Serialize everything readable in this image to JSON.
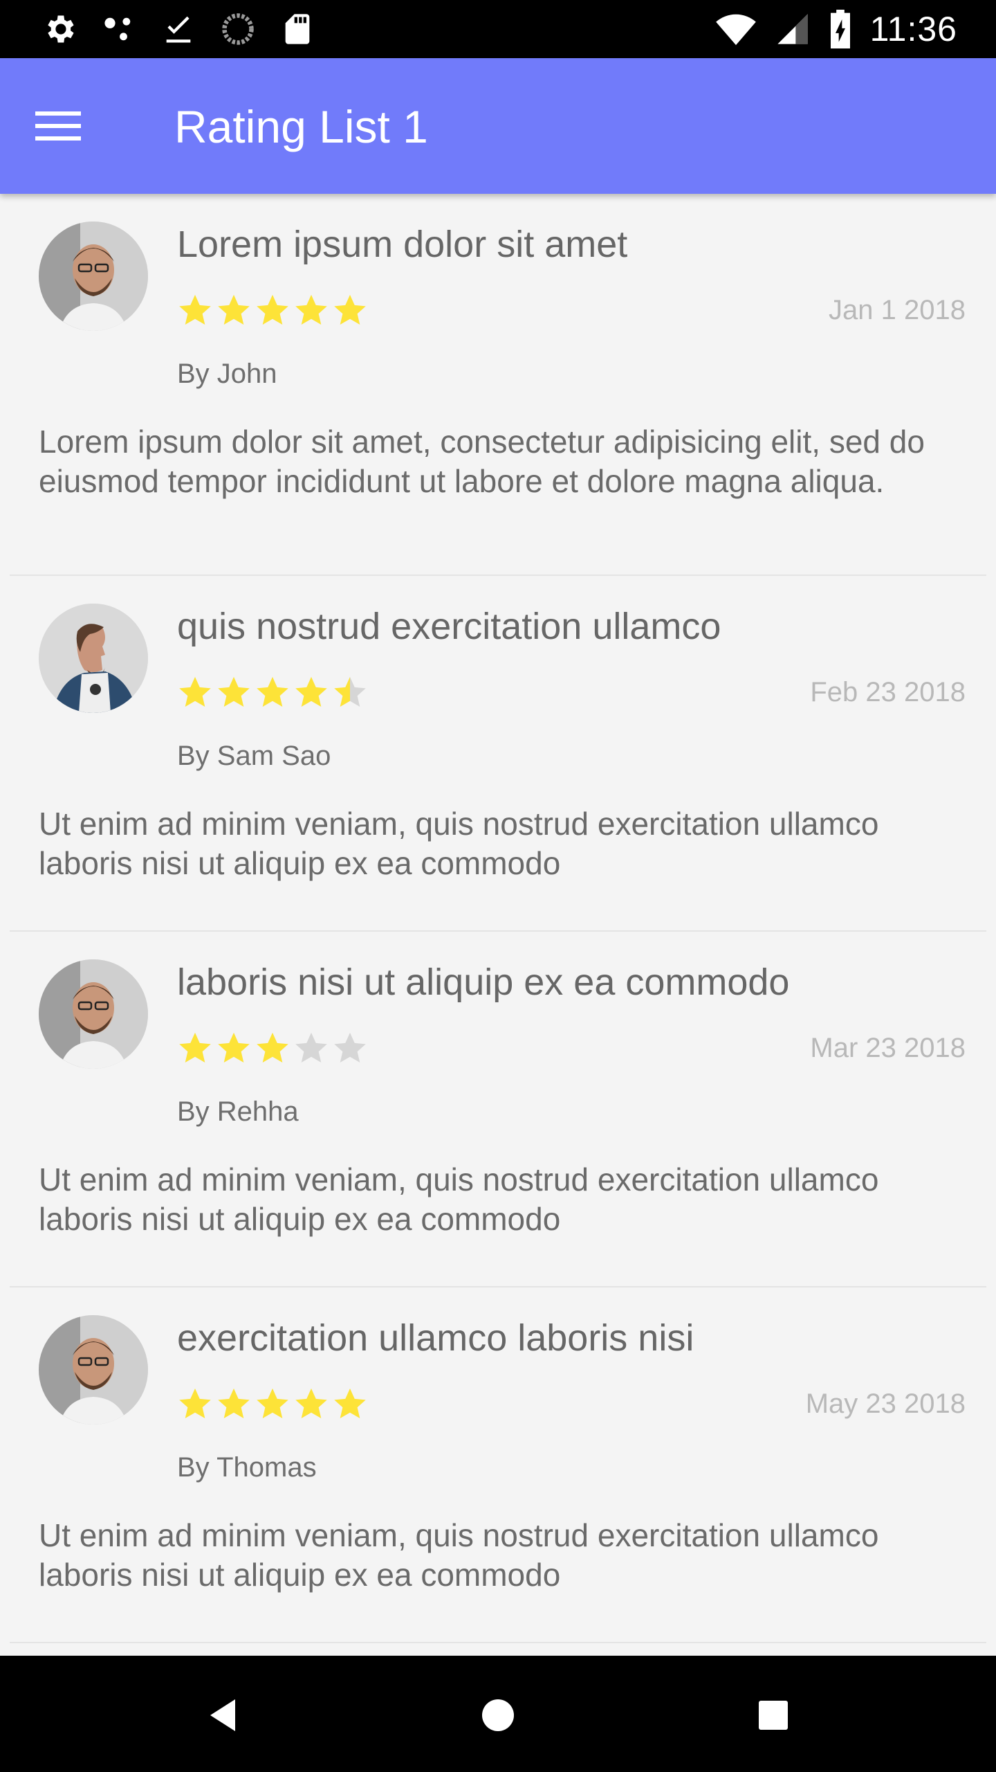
{
  "status_bar": {
    "time": "11:36",
    "left_icons": [
      "settings-icon",
      "dots-icon",
      "download-done-icon",
      "sync-icon",
      "sd-card-icon"
    ],
    "right_icons": [
      "wifi-icon",
      "signal-icon",
      "battery-charging-icon"
    ]
  },
  "app_bar": {
    "title": "Rating List 1",
    "menu_icon": "menu-icon",
    "color": "#717bfa"
  },
  "colors": {
    "star_filled": "#fde338",
    "star_empty": "#d6d6d6"
  },
  "reviews": [
    {
      "title": "Lorem ipsum dolor sit amet",
      "rating": 5,
      "date": "Jan 1 2018",
      "author": "By John",
      "body": "Lorem ipsum dolor sit amet, consectetur adipisicing elit, sed do eiusmod tempor incididunt ut labore et dolore magna aliqua."
    },
    {
      "title": "quis nostrud exercitation ullamco",
      "rating": 4.5,
      "date": "Feb 23 2018",
      "author": "By Sam Sao",
      "body": "Ut enim ad minim veniam, quis nostrud exercitation ullamco laboris nisi ut aliquip ex ea commodo"
    },
    {
      "title": "laboris nisi ut aliquip ex ea commodo",
      "rating": 3,
      "date": "Mar 23 2018",
      "author": "By Rehha",
      "body": "Ut enim ad minim veniam, quis nostrud exercitation ullamco laboris nisi ut aliquip ex ea commodo"
    },
    {
      "title": "exercitation ullamco laboris nisi",
      "rating": 5,
      "date": "May 23 2018",
      "author": "By Thomas",
      "body": "Ut enim ad minim veniam, quis nostrud exercitation ullamco laboris nisi ut aliquip ex ea commodo"
    }
  ],
  "nav_bar": {
    "buttons": [
      "back-icon",
      "home-icon",
      "recents-icon"
    ]
  }
}
